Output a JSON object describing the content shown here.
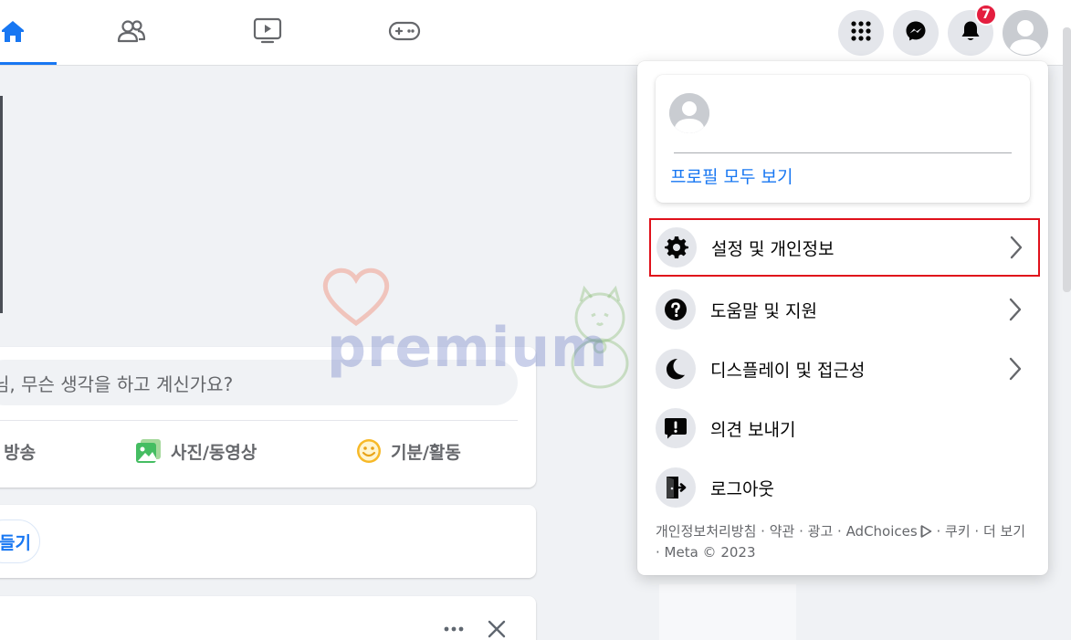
{
  "topbar": {
    "nav_tabs": [
      {
        "icon": "home-icon",
        "active": true
      },
      {
        "icon": "friends-icon",
        "active": false
      },
      {
        "icon": "watch-icon",
        "active": false
      },
      {
        "icon": "gaming-icon",
        "active": false
      }
    ],
    "notification_count": "7",
    "accent_color": "#1877f2",
    "badge_color": "#e41e3f"
  },
  "feed": {
    "composer_placeholder": "님, 무슨 생각을 하고 계신가요?",
    "actions": {
      "live": "브 방송",
      "photo": "사진/동영상",
      "feeling": "기분/활동"
    },
    "create_button": "들기"
  },
  "watermark": {
    "text": "premium"
  },
  "menu": {
    "profile_link": "프로필 모두 보기",
    "items": [
      {
        "label": "설정 및 개인정보",
        "icon": "gear-icon",
        "has_chevron": true,
        "highlighted": true
      },
      {
        "label": "도움말 및 지원",
        "icon": "help-icon",
        "has_chevron": true,
        "highlighted": false
      },
      {
        "label": "디스플레이 및 접근성",
        "icon": "moon-icon",
        "has_chevron": true,
        "highlighted": false
      },
      {
        "label": "의견 보내기",
        "icon": "feedback-icon",
        "has_chevron": false,
        "highlighted": false
      },
      {
        "label": "로그아웃",
        "icon": "logout-icon",
        "has_chevron": false,
        "highlighted": false
      }
    ],
    "footer": {
      "privacy": "개인정보처리방침",
      "terms": "약관",
      "ads": "광고",
      "adchoices": "AdChoices",
      "cookies": "쿠키",
      "more": "더 보기",
      "copyright": "Meta © 2023",
      "separator": " · "
    },
    "highlight_color": "#e0111b"
  }
}
